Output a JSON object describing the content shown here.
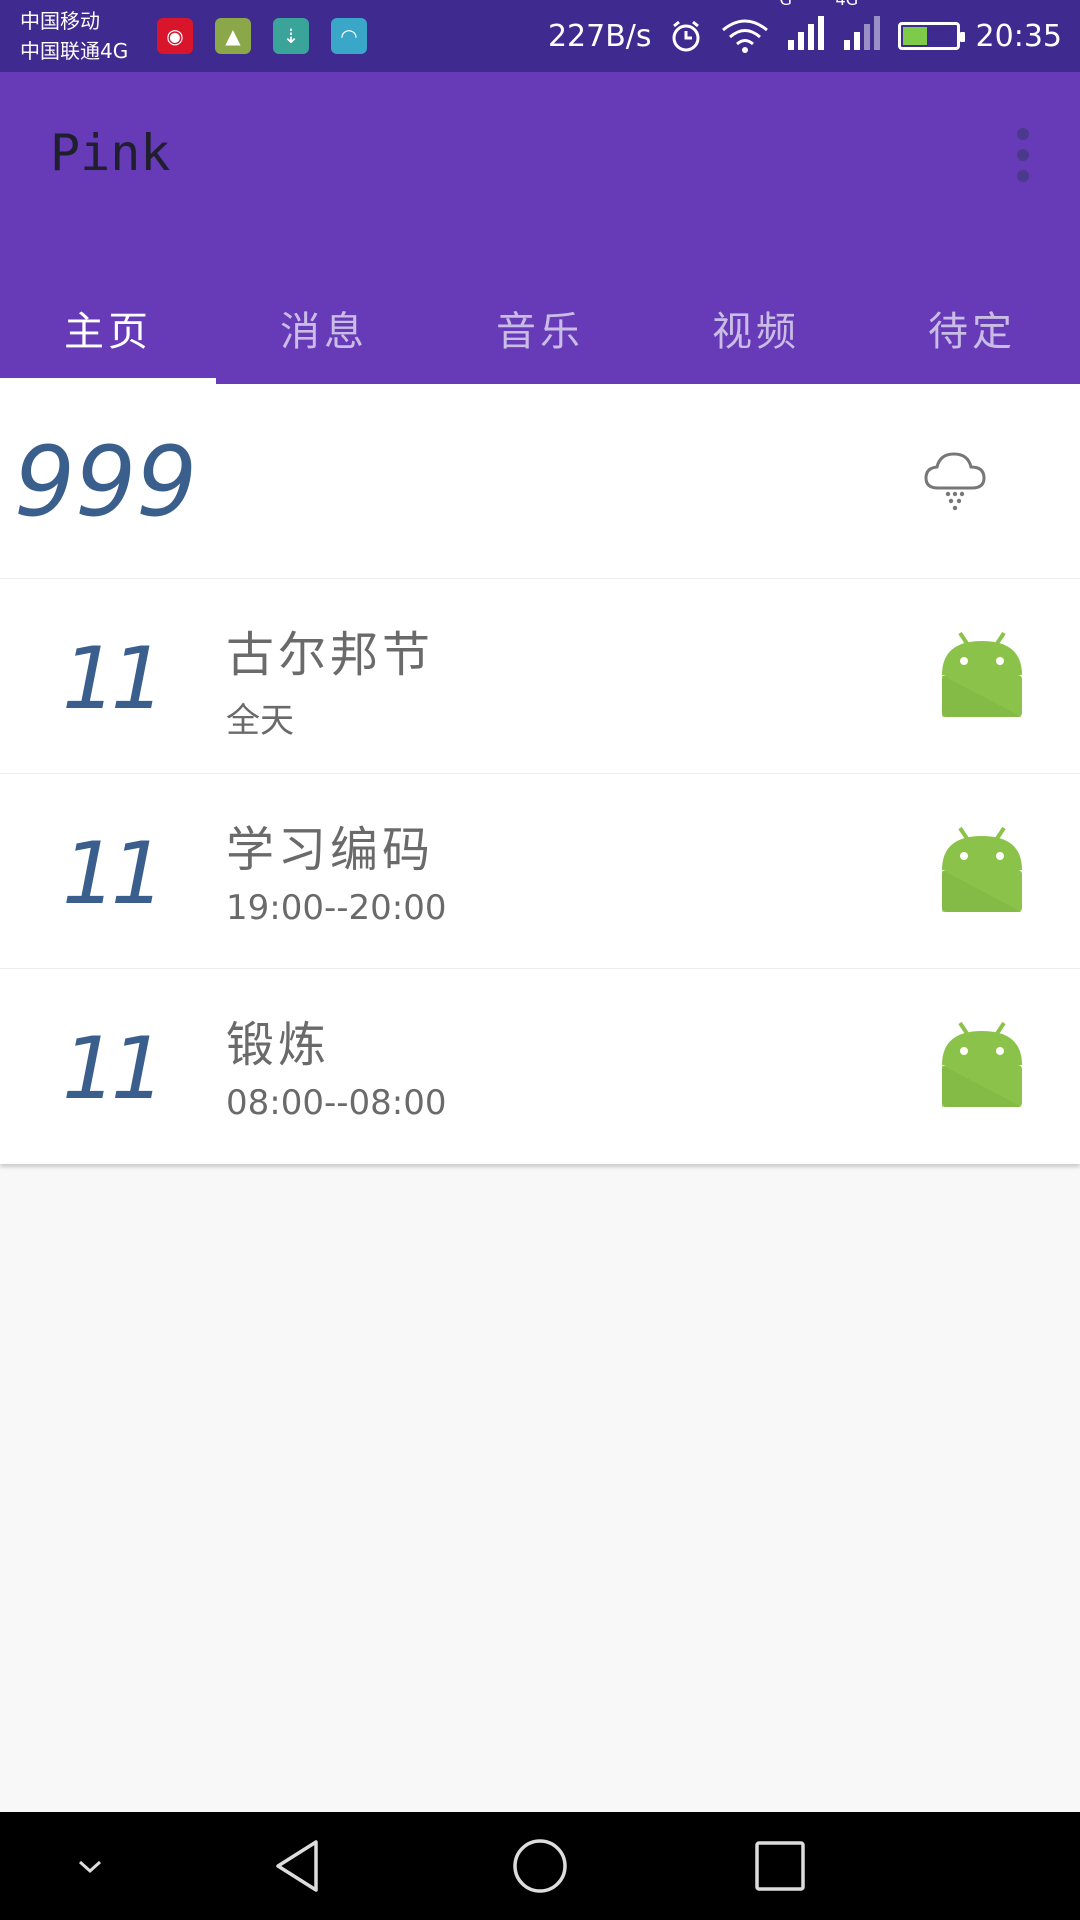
{
  "status_bar": {
    "carrier_1": "中国移动",
    "carrier_2": "中国联通4G",
    "speed": "227B/s",
    "time": "20:35",
    "signal_1_label": "G",
    "signal_2_label": "4G",
    "notification_icons": [
      "netease-music-icon",
      "android-icon",
      "usb-icon",
      "android-debug-icon"
    ]
  },
  "app_bar": {
    "title": "Pink"
  },
  "tabs": [
    {
      "label": "主页",
      "active": true
    },
    {
      "label": "消息",
      "active": false
    },
    {
      "label": "音乐",
      "active": false
    },
    {
      "label": "视频",
      "active": false
    },
    {
      "label": "待定",
      "active": false
    }
  ],
  "header": {
    "count": "999",
    "weather_icon": "cloud-snow-icon"
  },
  "events": [
    {
      "day": "11",
      "title": "古尔邦节",
      "subtitle": "全天",
      "icon": "android-icon"
    },
    {
      "day": "11",
      "title": "学习编码",
      "subtitle": "19:00--20:00",
      "icon": "android-icon"
    },
    {
      "day": "11",
      "title": "锻炼",
      "subtitle": "08:00--08:00",
      "icon": "android-icon"
    }
  ],
  "colors": {
    "primary": "#673ab7",
    "status_bar": "#3f2a8f",
    "number_blue": "#3b5f8c",
    "android_green": "#8bc34a"
  }
}
